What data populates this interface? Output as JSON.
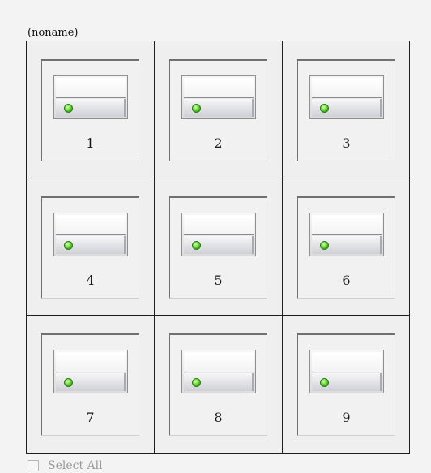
{
  "group": {
    "title": "(noname)"
  },
  "devices": [
    {
      "label": "1",
      "status": "online",
      "status_color": "#4fd11f"
    },
    {
      "label": "2",
      "status": "online",
      "status_color": "#4fd11f"
    },
    {
      "label": "3",
      "status": "online",
      "status_color": "#4fd11f"
    },
    {
      "label": "4",
      "status": "online",
      "status_color": "#4fd11f"
    },
    {
      "label": "5",
      "status": "online",
      "status_color": "#4fd11f"
    },
    {
      "label": "6",
      "status": "online",
      "status_color": "#4fd11f"
    },
    {
      "label": "7",
      "status": "online",
      "status_color": "#4fd11f"
    },
    {
      "label": "8",
      "status": "online",
      "status_color": "#4fd11f"
    },
    {
      "label": "9",
      "status": "online",
      "status_color": "#4fd11f"
    }
  ],
  "select_all": {
    "label": "Select All",
    "checked": false
  }
}
